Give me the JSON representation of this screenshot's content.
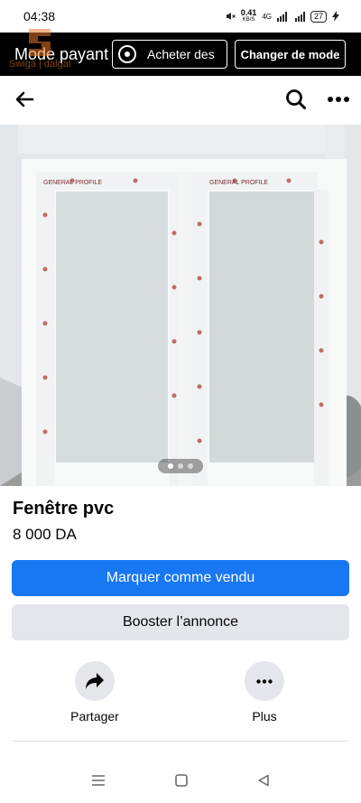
{
  "status_bar": {
    "time": "04:38",
    "net_speed_value": "0.41",
    "net_speed_unit": "KB/S",
    "network": "4G",
    "battery": "27"
  },
  "paid_bar": {
    "title": "Mode payant",
    "buy_label": "Acheter des",
    "mode_label": "Changer de mode"
  },
  "watermark": {
    "text": "Swiga | dalgat"
  },
  "nav": {
    "back_icon": "arrow-left-icon",
    "search_icon": "search-icon",
    "more_icon": "more-horizontal-icon"
  },
  "listing": {
    "image_alt": "PVC double window with GENERAL PROFILE protective film",
    "film_brand": "GENERAL PROFILE",
    "title": "Fenêtre pvc",
    "price": "8 000 DA",
    "photo_count": 3,
    "active_photo": 1
  },
  "buttons": {
    "mark_sold": "Marquer comme vendu",
    "boost": "Booster l’annonce"
  },
  "actions": [
    {
      "label": "Partager",
      "icon": "share-arrow-icon"
    },
    {
      "label": "Plus",
      "icon": "more-horizontal-icon"
    }
  ],
  "colors": {
    "primary": "#1877f2",
    "secondary": "#e4e6eb",
    "paid_bar": "#000000"
  }
}
